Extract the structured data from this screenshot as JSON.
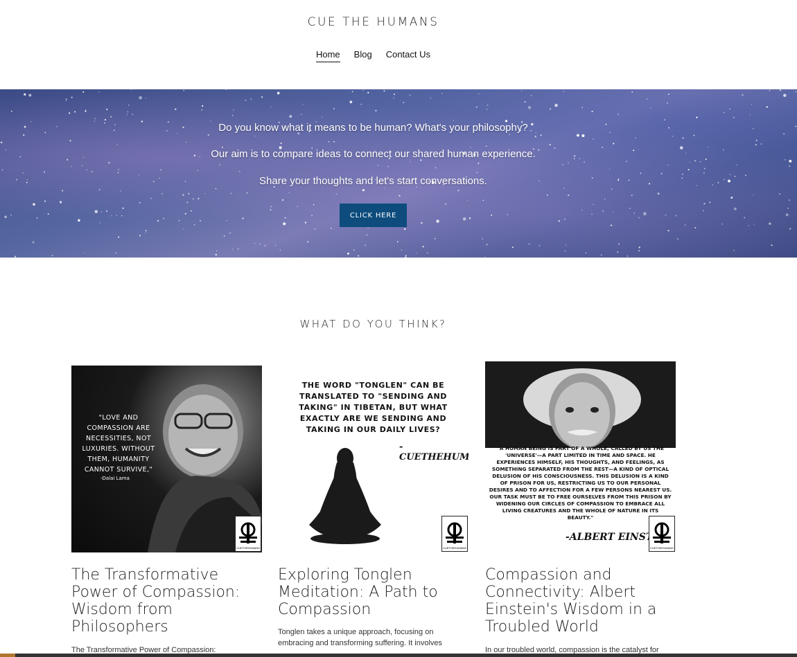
{
  "site": {
    "title": "CUE THE HUMANS"
  },
  "nav": {
    "items": [
      {
        "label": "Home",
        "active": true
      },
      {
        "label": "Blog",
        "active": false
      },
      {
        "label": "Contact Us",
        "active": false
      }
    ]
  },
  "hero": {
    "line1": "Do you know what it means to be human? What's your philosophy?",
    "line2": "Our aim is to compare ideas to connect our shared human experience.",
    "line3": "Share your thoughts and let's start conversations.",
    "button_label": "CLICK HERE",
    "button_color": "#0d4c7d"
  },
  "section": {
    "title": "WHAT DO YOU THINK?"
  },
  "cards": [
    {
      "title": "The Transformative Power of Compassion: Wisdom from Philosophers",
      "excerpt": "The Transformative Power of Compassion:",
      "image": {
        "quote": "\"LOVE AND COMPASSION ARE NECESSITIES, NOT LUXURIES. WITHOUT THEM, HUMANITY CANNOT SURVIVE,\"",
        "attribution": "-Dalai Lama",
        "logo_text": "CUETHEHUMANS"
      }
    },
    {
      "title": "Exploring Tonglen Meditation: A Path to Compassion",
      "excerpt": "Tonglen takes a unique approach, focusing on embracing and transforming suffering. It involves",
      "image": {
        "quote": "THE WORD \"TONGLEN\" CAN BE TRANSLATED TO \"SENDING AND TAKING\" IN TIBETAN, BUT WHAT EXACTLY ARE WE SENDING AND TAKING IN OUR DAILY LIVES?",
        "signature": "-CUETHEHUMANS",
        "logo_text": "CUETHEHUMANS"
      }
    },
    {
      "title": "Compassion and Connectivity: Albert Einstein's Wisdom in a Troubled World",
      "excerpt": "In our troubled world, compassion is the catalyst for",
      "image": {
        "quote": "\"A HUMAN BEING IS PART OF A WHOLE, CALLED BY US THE 'UNIVERSE'—A PART LIMITED IN TIME AND SPACE. HE EXPERIENCES HIMSELF, HIS THOUGHTS, AND FEELINGS, AS SOMETHING SEPARATED FROM THE REST—A KIND OF OPTICAL DELUSION OF HIS CONSCIOUSNESS. THIS DELUSION IS A KIND OF PRISON FOR US, RESTRICTING US TO OUR PERSONAL DESIRES AND TO AFFECTION FOR A FEW PERSONS NEAREST US. OUR TASK MUST BE TO FREE OURSELVES FROM THIS PRISON BY WIDENING OUR CIRCLES OF COMPASSION TO EMBRACE ALL LIVING CREATURES AND THE WHOLE OF NATURE IN ITS BEAUTY.\"",
        "signature": "-ALBERT EINSTEIN",
        "logo_text": "CUETHEHUMANS"
      }
    }
  ]
}
